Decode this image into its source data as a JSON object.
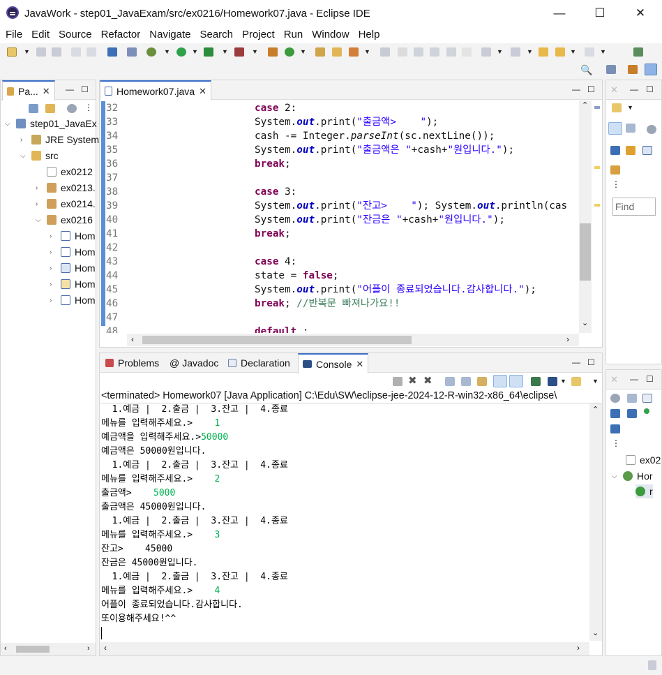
{
  "window": {
    "title": "JavaWork - step01_JavaExam/src/ex0216/Homework07.java - Eclipse IDE",
    "min": "—",
    "max": "☐",
    "close": "✕"
  },
  "menu": [
    "File",
    "Edit",
    "Source",
    "Refactor",
    "Navigate",
    "Search",
    "Project",
    "Run",
    "Window",
    "Help"
  ],
  "explorer": {
    "tab": "Pa...",
    "rows": [
      "step01_JavaEx",
      "JRE System",
      "src",
      "ex0212",
      "ex0213.",
      "ex0214.",
      "ex0216",
      "Hom",
      "Hom",
      "Hom",
      "Hom",
      "Hom"
    ]
  },
  "editor": {
    "tab": "Homework07.java",
    "line_numbers": [
      "32",
      "33",
      "34",
      "35",
      "36",
      "37",
      "38",
      "39",
      "40",
      "41",
      "42",
      "43",
      "44",
      "45",
      "46",
      "47",
      "48"
    ]
  },
  "code": {
    "l32": {
      "kw": "case",
      "rest": " 2:"
    },
    "l33": {
      "a": "System.",
      "f": "out",
      "b": ".print(",
      "s": "\"출금액>    \"",
      "c": ");"
    },
    "l34": {
      "a": "cash -= Integer.",
      "m": "parseInt",
      "b": "(sc.nextLine());"
    },
    "l35": {
      "a": "System.",
      "f": "out",
      "b": ".print(",
      "s1": "\"출금액은 \"",
      "mid": "+cash+",
      "s2": "\"원입니다.\"",
      "c": ");"
    },
    "l36": {
      "kw": "break",
      "rest": ";"
    },
    "l38": {
      "kw": "case",
      "rest": " 3:"
    },
    "l39": {
      "a": "System.",
      "f": "out",
      "b": ".print(",
      "s": "\"잔고>    \"",
      "c": "); System.",
      "f2": "out",
      "d": ".println(cas"
    },
    "l40": {
      "a": "System.",
      "f": "out",
      "b": ".print(",
      "s1": "\"잔금은 \"",
      "mid": "+cash+",
      "s2": "\"원입니다.\"",
      "c": ");"
    },
    "l41": {
      "kw": "break",
      "rest": ";"
    },
    "l43": {
      "kw": "case",
      "rest": " 4:"
    },
    "l44": {
      "a": "state = ",
      "kw": "false",
      "rest": ";"
    },
    "l45": {
      "a": "System.",
      "f": "out",
      "b": ".print(",
      "s": "\"어플이 종료되었습니다.감사합니다.\"",
      "c": ");"
    },
    "l46": {
      "kw": "break",
      "rest": "; ",
      "cmt": "//반복문 빠져나가요!!"
    },
    "l48": {
      "kw": "default",
      "rest": " :"
    }
  },
  "bottom_tabs": [
    "Problems",
    "Javadoc",
    "Declaration",
    "Console"
  ],
  "console": {
    "header": "<terminated> Homework07 [Java Application] C:\\Edu\\SW\\eclipse-jee-2024-12-R-win32-x86_64\\eclipse\\",
    "lines": [
      {
        "t": "  1.예금 |  2.출금 |  3.잔고 |  4.종료",
        "i": ""
      },
      {
        "t": "메뉴를 입력해주세요.>    ",
        "i": "1"
      },
      {
        "t": "예금액을 입력해주세요.>",
        "i": "50000"
      },
      {
        "t": "예금액은 50000원입니다.",
        "i": ""
      },
      {
        "t": "  1.예금 |  2.출금 |  3.잔고 |  4.종료",
        "i": ""
      },
      {
        "t": "메뉴를 입력해주세요.>    ",
        "i": "2"
      },
      {
        "t": "출금액>    ",
        "i": "5000"
      },
      {
        "t": "출금액은 45000원입니다.",
        "i": ""
      },
      {
        "t": "  1.예금 |  2.출금 |  3.잔고 |  4.종료",
        "i": ""
      },
      {
        "t": "메뉴를 입력해주세요.>    ",
        "i": "3"
      },
      {
        "t": "잔고>    45000",
        "i": ""
      },
      {
        "t": "잔금은 45000원입니다.",
        "i": ""
      },
      {
        "t": "  1.예금 |  2.출금 |  3.잔고 |  4.종료",
        "i": ""
      },
      {
        "t": "메뉴를 입력해주세요.>    ",
        "i": "4"
      },
      {
        "t": "어플이 종료되었습니다.감사합니다.",
        "i": ""
      },
      {
        "t": "또이용해주세요!^^",
        "i": ""
      }
    ]
  },
  "right_panel": {
    "find_placeholder": "Find",
    "outline_rows": [
      "ex02",
      "Hor",
      "r"
    ]
  }
}
